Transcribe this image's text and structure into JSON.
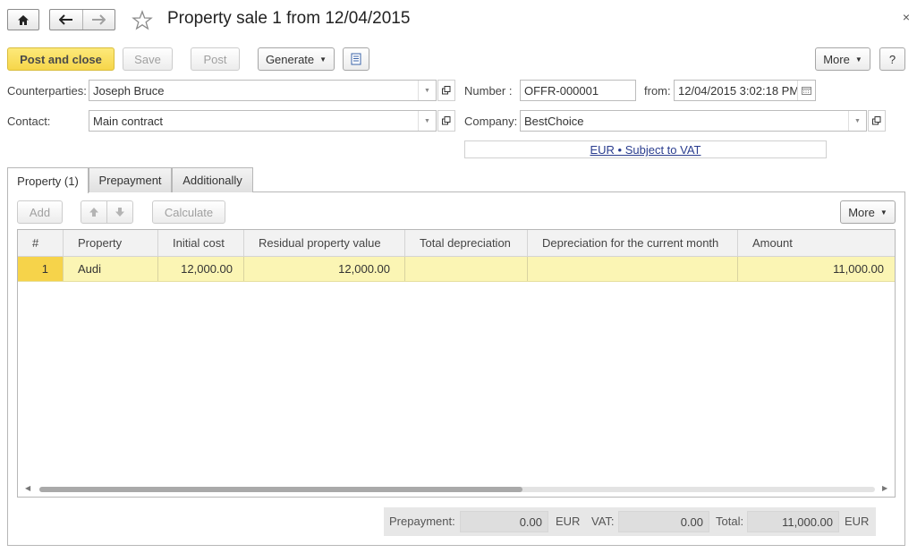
{
  "window": {
    "title": "Property sale 1 from 12/04/2015",
    "close_label": "×"
  },
  "toolbar": {
    "post_close_label": "Post and close",
    "save_label": "Save",
    "post_label": "Post",
    "generate_label": "Generate",
    "more_label": "More",
    "help_label": "?"
  },
  "form": {
    "counterparties_label": "Counterparties:",
    "counterparties_value": "Joseph Bruce",
    "contact_label": "Contact:",
    "contact_value": "Main contract",
    "number_label": "Number :",
    "number_value": "OFFR-000001",
    "from_label": "from:",
    "date_value": "12/04/2015  3:02:18 PM",
    "company_label": "Company:",
    "company_value": "BestChoice",
    "vat_link": "EUR • Subject to VAT"
  },
  "tabs": [
    {
      "label": "Property (1)",
      "active": true
    },
    {
      "label": "Prepayment",
      "active": false
    },
    {
      "label": "Additionally",
      "active": false
    }
  ],
  "table_toolbar": {
    "add_label": "Add",
    "calculate_label": "Calculate",
    "more_label": "More"
  },
  "table": {
    "columns": [
      "#",
      "Property",
      "Initial cost",
      "Residual property value",
      "Total depreciation",
      "Depreciation for the current month",
      "Amount"
    ],
    "rows": [
      {
        "index": "1",
        "property": "Audi",
        "initial_cost": "12,000.00",
        "residual_value": "12,000.00",
        "total_depreciation": "",
        "depreciation_month": "",
        "amount": "11,000.00"
      }
    ]
  },
  "totals": {
    "prepayment_label": "Prepayment:",
    "prepayment_value": "0.00",
    "currency1": "EUR",
    "vat_label": "VAT:",
    "vat_value": "0.00",
    "total_label": "Total:",
    "total_value": "11,000.00",
    "currency2": "EUR"
  },
  "colors": {
    "primary_button": "#f6d64a",
    "selected_row": "#fbf5b4",
    "selected_index": "#f6d34a",
    "link": "#2a3d8f"
  }
}
